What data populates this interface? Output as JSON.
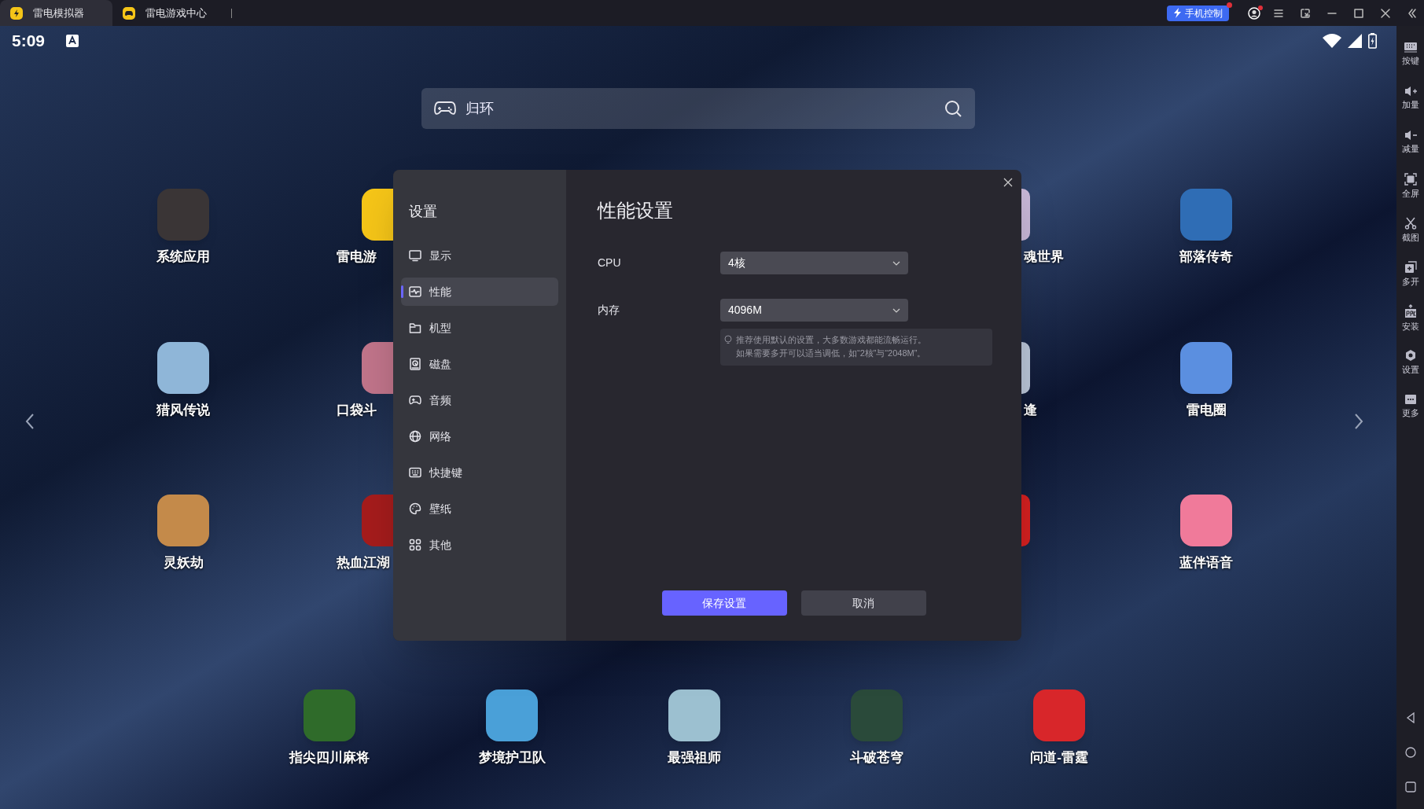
{
  "tabs": [
    {
      "label": "雷电模拟器",
      "selected": true
    },
    {
      "label": "雷电游戏中心",
      "selected": false
    }
  ],
  "titlebar": {
    "phone_control": {
      "label": "手机控制",
      "notification": true
    },
    "account": {
      "notification": true
    }
  },
  "status_bar": {
    "time": "5:09"
  },
  "search": {
    "value": "归环"
  },
  "desktop": {
    "rows": [
      [
        {
          "label": "系统应用",
          "color": "#3a3536"
        },
        {
          "label": "雷电游",
          "color": "#f5c518"
        },
        {
          "label": "魂世界",
          "color": "#c9b8d8"
        },
        {
          "label": "部落传奇",
          "color": "#2f6db5"
        }
      ],
      [
        {
          "label": "猎风传说",
          "color": "#8fb6d8"
        },
        {
          "label": "口袋斗",
          "color": "#c0748a"
        },
        {
          "label": "逢",
          "color": "#b9c4d6"
        },
        {
          "label": "雷电圈",
          "color": "#5b8fe0"
        }
      ],
      [
        {
          "label": "灵妖劫",
          "color": "#c48a4a"
        },
        {
          "label": "热血江湖",
          "color": "#a51c1c"
        },
        {
          "color": "#d42020"
        },
        {
          "label": "蓝伴语音",
          "color": "#f07a9a"
        }
      ]
    ],
    "dock": [
      {
        "label": "指尖四川麻将",
        "color": "#2f6b2a"
      },
      {
        "label": "梦境护卫队",
        "color": "#4aa0d8"
      },
      {
        "label": "最强祖师",
        "color": "#9cc0d0"
      },
      {
        "label": "斗破苍穹",
        "color": "#2a4a3a"
      },
      {
        "label": "问道-雷霆",
        "color": "#d8262a"
      }
    ]
  },
  "side_toolbar": [
    "按键",
    "加量",
    "减量",
    "全屏",
    "截图",
    "多开",
    "安装",
    "设置",
    "更多"
  ],
  "dialog": {
    "sidebar_title": "设置",
    "menu": [
      {
        "label": "显示",
        "selected": false
      },
      {
        "label": "性能",
        "selected": true
      },
      {
        "label": "机型",
        "selected": false
      },
      {
        "label": "磁盘",
        "selected": false
      },
      {
        "label": "音频",
        "selected": false
      },
      {
        "label": "网络",
        "selected": false
      },
      {
        "label": "快捷键",
        "selected": false
      },
      {
        "label": "壁纸",
        "selected": false
      },
      {
        "label": "其他",
        "selected": false
      }
    ],
    "title": "性能设置",
    "fields": [
      {
        "label": "CPU",
        "value": "4核"
      },
      {
        "label": "内存",
        "value": "4096M"
      }
    ],
    "hint": [
      "推荐使用默认的设置，大多数游戏都能流畅运行。",
      "如果需要多开可以适当调低，如“2核”与“2048M”。"
    ],
    "buttons": [
      {
        "label": "保存设置",
        "kind": "primary"
      },
      {
        "label": "取消",
        "kind": "secondary"
      }
    ]
  }
}
